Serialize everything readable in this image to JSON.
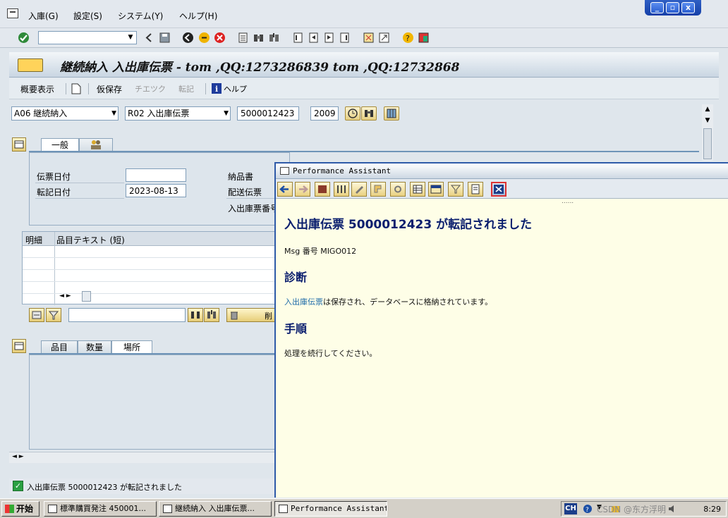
{
  "menubar": {
    "items": [
      "入庫(G)",
      "設定(S)",
      "システム(Y)",
      "ヘルプ(H)"
    ]
  },
  "window_controls": [
    "_",
    "▫",
    "x"
  ],
  "title": "継続納入 入出庫伝票 - tom ,QQ:1273286839 tom ,QQ:12732868",
  "app_toolbar": {
    "overview": "概要表示",
    "hold": "仮保存",
    "check": "チエツク",
    "post": "転記",
    "help": "ヘルプ"
  },
  "header": {
    "action": "A06 継続納入",
    "reference": "R02 入出庫伝票",
    "doc_number": "5000012423",
    "year": "2009"
  },
  "tabs_top": [
    "一般"
  ],
  "general": {
    "doc_date_label": "伝票日付",
    "doc_date_value": "",
    "post_date_label": "転記日付",
    "post_date_value": "2023-08-13",
    "delivery_note_label": "納品書",
    "shipping_label": "配送伝票",
    "slip_no_label": "入出庫票番号"
  },
  "table": {
    "col_detail": "明細",
    "col_text": "品目テキスト (短)"
  },
  "delete_label": "削",
  "tabs_bottom": [
    "品目",
    "数量",
    "場所"
  ],
  "status": {
    "text": "入出庫伝票 5000012423 が転記されました"
  },
  "pa": {
    "title": "Performance Assistant",
    "heading": "入出庫伝票 5000012423 が転記されました",
    "msg": "Msg 番号 MIGO012",
    "diag_heading": "診断",
    "diag_link": "入出庫伝票",
    "diag_text": "は保存され、データベースに格納されています。",
    "proc_heading": "手順",
    "proc_text": "処理を続行してください。"
  },
  "taskbar": {
    "start": "开始",
    "tasks": [
      "標準購買発注 450001...",
      "継続納入 入出庫伝票...",
      "Performance Assistant"
    ],
    "ime": "CH",
    "clock": "8:29",
    "watermark": "CSDN @东方浮明"
  }
}
